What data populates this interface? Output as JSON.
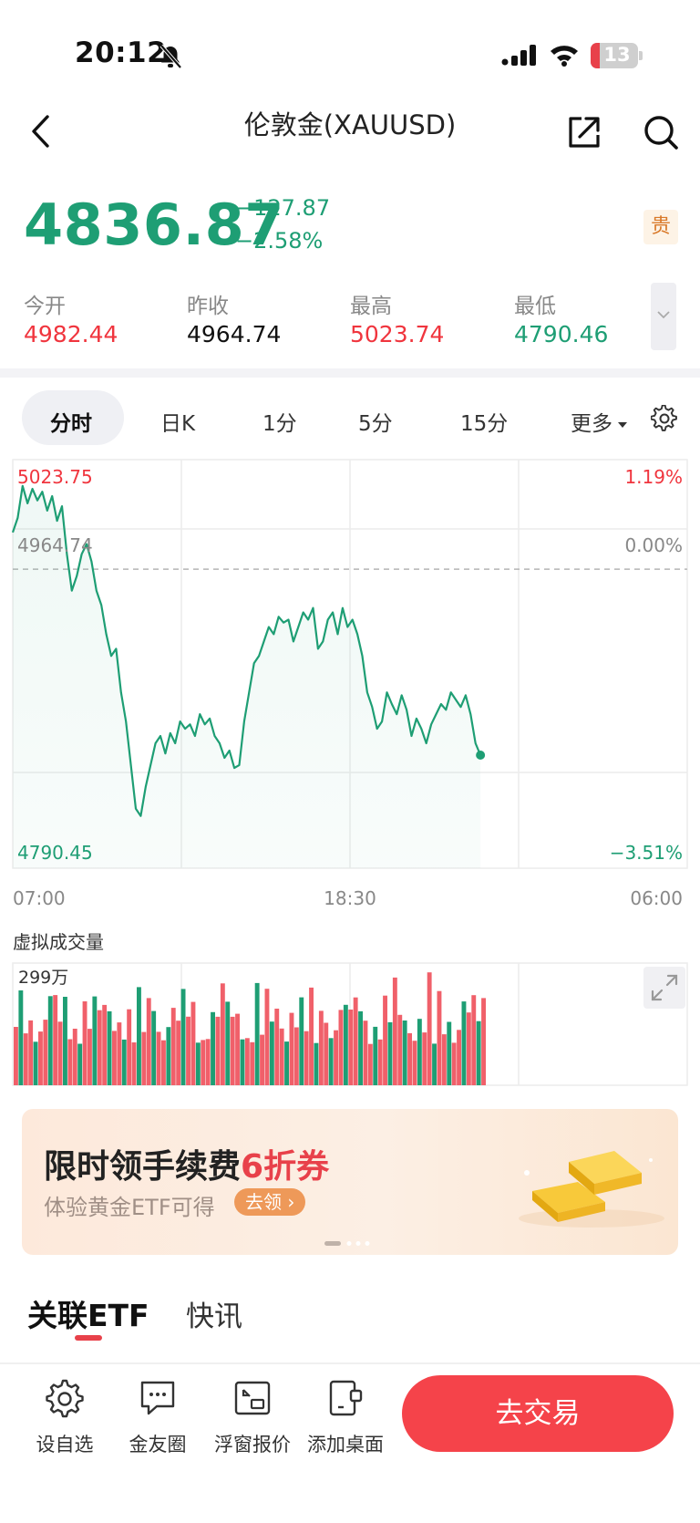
{
  "status_bar": {
    "time": "20:12",
    "battery": "13"
  },
  "header": {
    "title": "伦敦金(XAUUSD)"
  },
  "quote": {
    "price": "4836.87",
    "change_abs": "−127.87",
    "change_pct": "−2.58%",
    "badge": "贵",
    "stats": [
      {
        "label": "今开",
        "value": "4982.44",
        "color": "#f0353e"
      },
      {
        "label": "昨收",
        "value": "4964.74",
        "color": "#111111"
      },
      {
        "label": "最高",
        "value": "5023.74",
        "color": "#f0353e"
      },
      {
        "label": "最低",
        "value": "4790.46",
        "color": "#1e9e74"
      }
    ]
  },
  "tabs": [
    "分时",
    "日K",
    "1分",
    "5分",
    "15分",
    "更多"
  ],
  "chart_data": {
    "type": "line",
    "y_top_label": "5023.75",
    "y_ref_label": "4964.74",
    "y_bottom_label": "4790.45",
    "pct_top": "1.19%",
    "pct_ref": "0.00%",
    "pct_bottom": "−3.51%",
    "x_labels": [
      "07:00",
      "18:30",
      "06:00"
    ],
    "ylim": [
      4790.45,
      5023.75
    ],
    "ref_value": 4964.74,
    "total_points": 138,
    "y": [
      4990,
      5000,
      5022,
      5010,
      5020,
      5012,
      5018,
      5005,
      5015,
      4998,
      5008,
      4975,
      4950,
      4960,
      4975,
      4982,
      4970,
      4950,
      4940,
      4920,
      4905,
      4910,
      4880,
      4860,
      4830,
      4800,
      4795,
      4815,
      4830,
      4845,
      4850,
      4838,
      4852,
      4845,
      4860,
      4855,
      4858,
      4850,
      4865,
      4858,
      4862,
      4850,
      4845,
      4835,
      4840,
      4828,
      4830,
      4860,
      4880,
      4900,
      4905,
      4915,
      4925,
      4920,
      4932,
      4928,
      4930,
      4915,
      4925,
      4935,
      4930,
      4938,
      4910,
      4915,
      4930,
      4935,
      4920,
      4938,
      4925,
      4930,
      4920,
      4905,
      4880,
      4870,
      4855,
      4860,
      4880,
      4872,
      4865,
      4878,
      4868,
      4850,
      4862,
      4855,
      4845,
      4858,
      4865,
      4872,
      4868,
      4880,
      4875,
      4870,
      4878,
      4865,
      4845,
      4836.87
    ],
    "volume_label": "虚拟成交量",
    "volume_max_label": "299万",
    "volume_bars": 96
  },
  "banner": {
    "title_prefix": "限时领手续费",
    "title_highlight": "6折券",
    "subtitle": "体验黄金ETF可得",
    "button": "去领"
  },
  "section_tabs": [
    "关联ETF",
    "快讯"
  ],
  "bottom_bar": {
    "items": [
      "设自选",
      "金友圈",
      "浮窗报价",
      "添加桌面"
    ],
    "trade_button": "去交易"
  },
  "colors": {
    "up": "#f0353e",
    "down": "#1e9e74",
    "accent": "#f5434a"
  }
}
